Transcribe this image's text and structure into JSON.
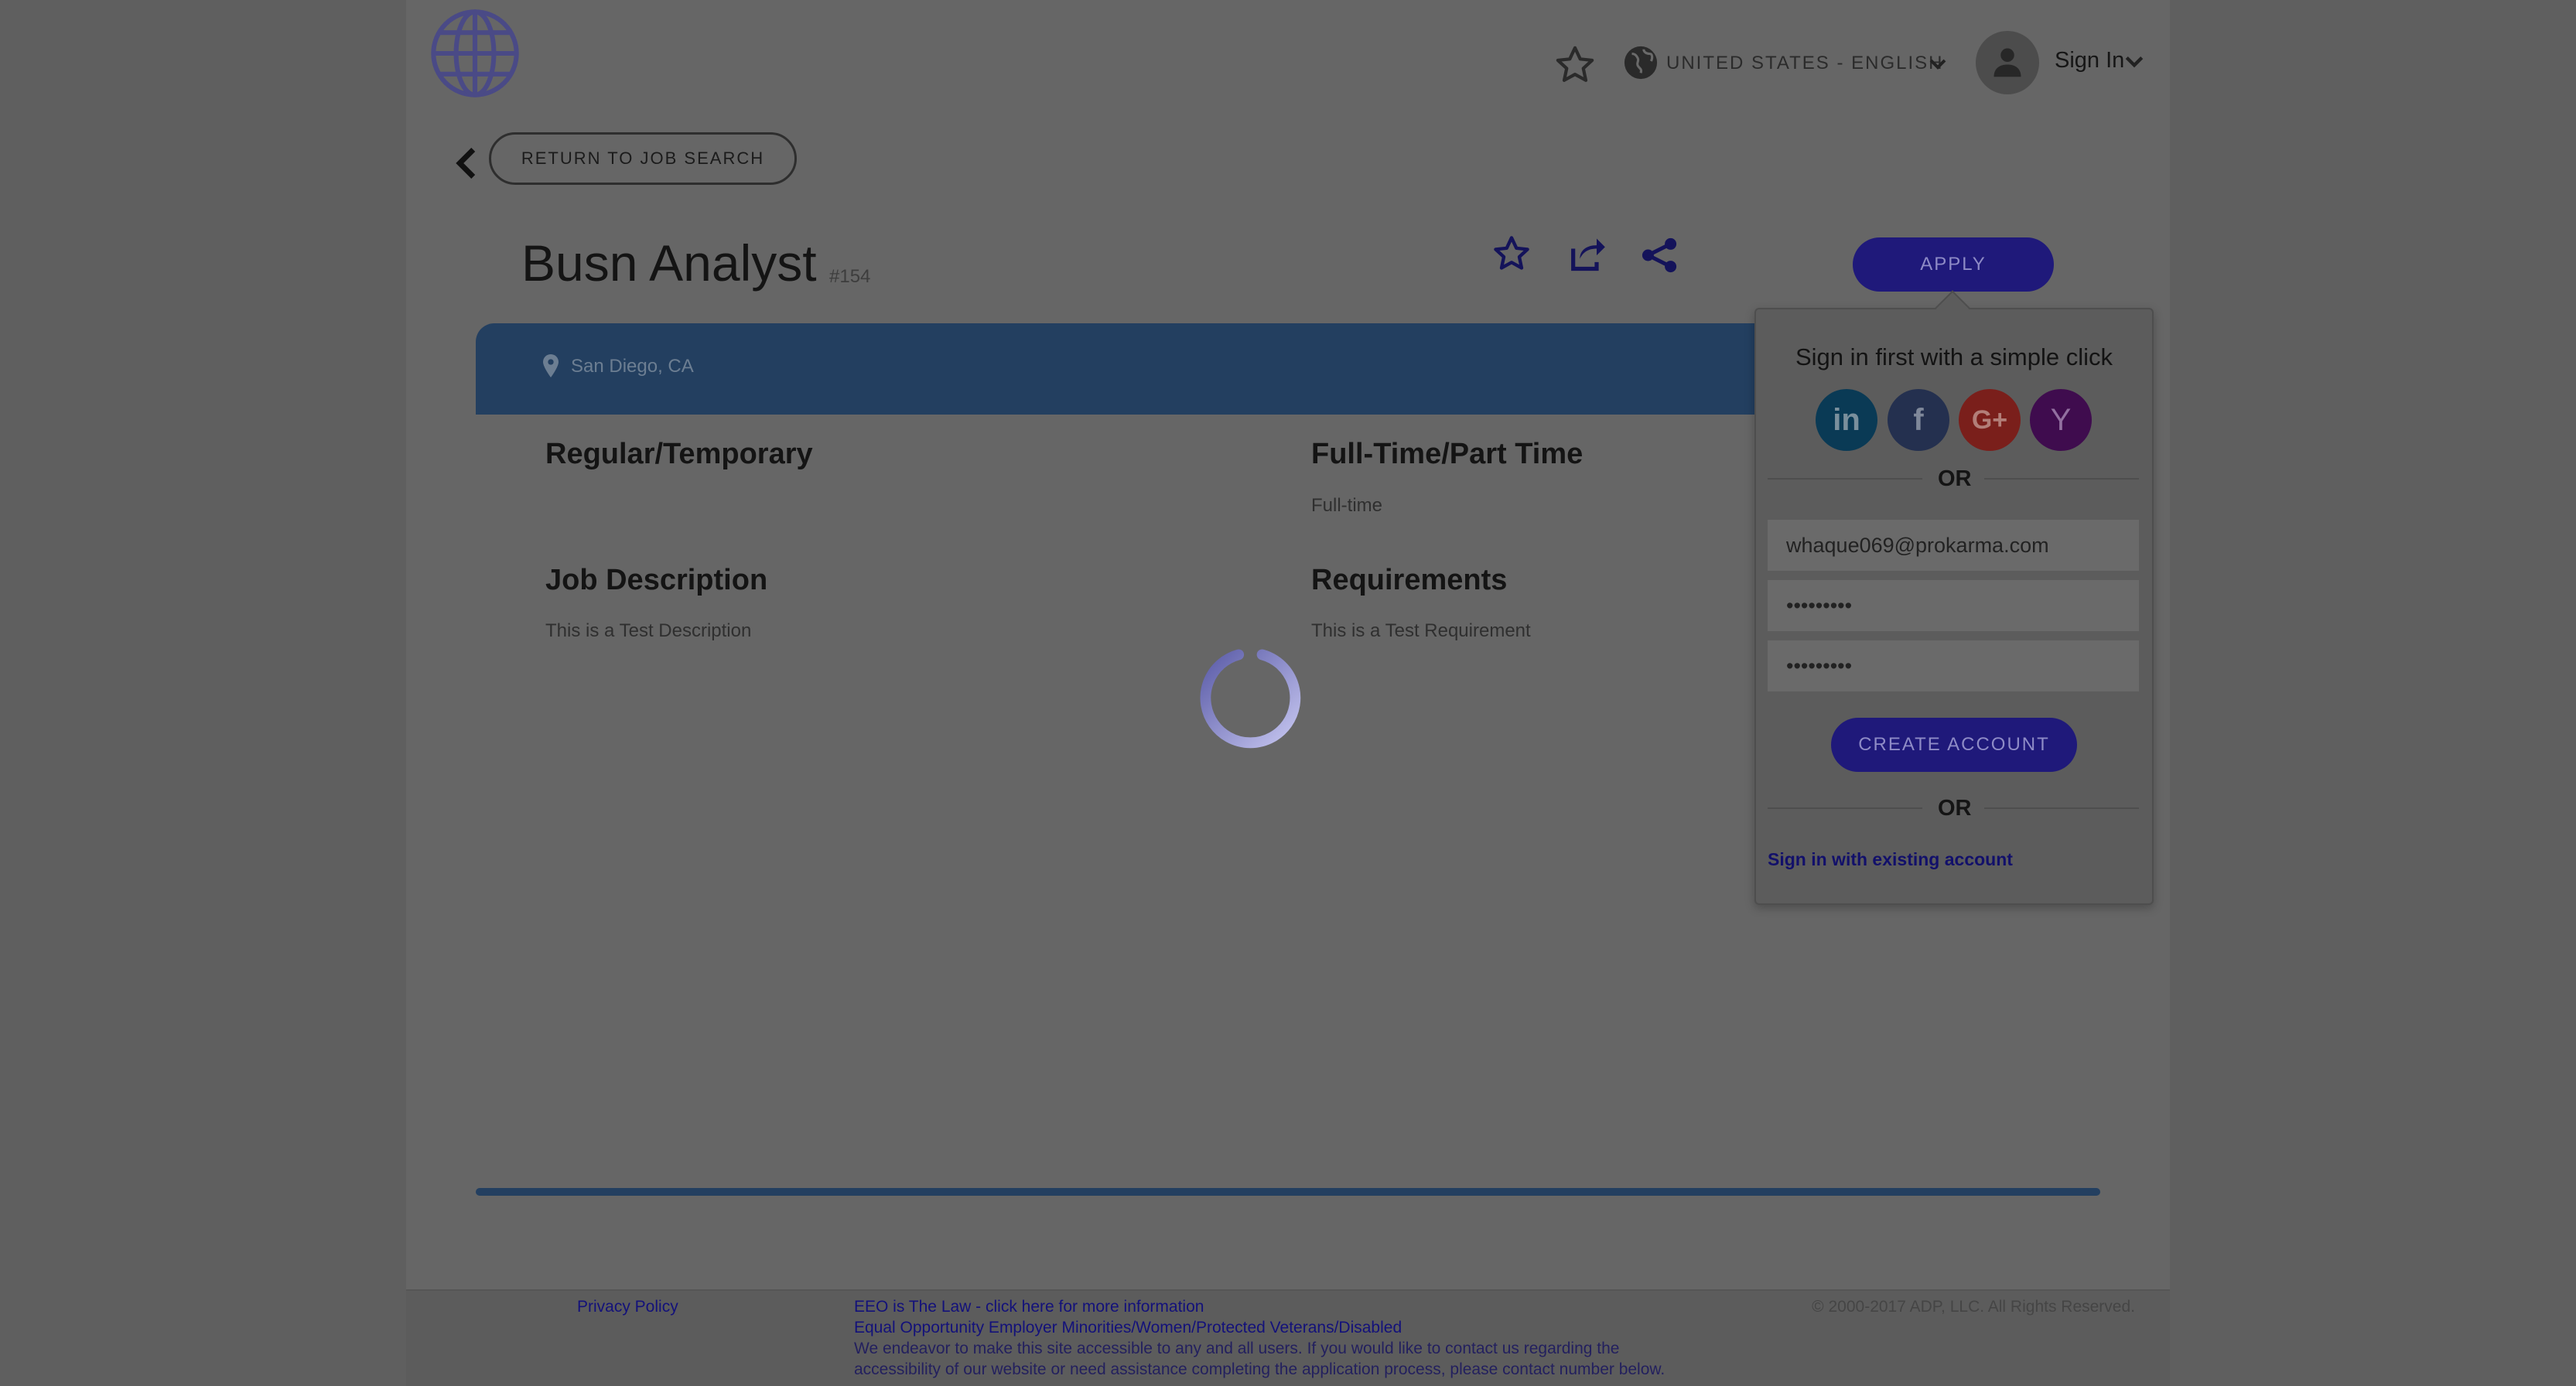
{
  "header": {
    "language": "UNITED STATES - ENGLISH",
    "signin_label": "Sign In"
  },
  "nav": {
    "return_label": "RETURN TO JOB SEARCH"
  },
  "job": {
    "title": "Busn Analyst",
    "number": "#154",
    "location": "San Diego, CA",
    "sections": {
      "regular_label": "Regular/Temporary",
      "regular_value": "",
      "fulltime_label": "Full-Time/Part Time",
      "fulltime_value": "Full-time",
      "description_label": "Job Description",
      "description_value": "This is a Test Description",
      "requirements_label": "Requirements",
      "requirements_value": "This is a Test Requirement"
    }
  },
  "apply": {
    "button_label": "APPLY",
    "heading": "Sign in first with a simple click",
    "social": [
      "in",
      "f",
      "G+",
      "Y"
    ],
    "or_label": "OR",
    "email_value": "whaque069@prokarma.com",
    "password_value": "•••••••••",
    "confirm_value": "•••••••••",
    "create_label": "CREATE ACCOUNT",
    "existing_label": "Sign in with existing account"
  },
  "footer": {
    "privacy": "Privacy Policy",
    "eeo": "EEO is The Law - click here for more information",
    "equal_opportunity": "Equal Opportunity Employer Minorities/Women/Protected Veterans/Disabled",
    "accessibility_1": "We endeavor to make this site accessible to any and all users. If you would like to contact us regarding the",
    "accessibility_2": "accessibility of our website or need assistance completing the application process, please contact number below.",
    "copyright": "© 2000-2017 ADP, LLC. All Rights Reserved."
  },
  "colors": {
    "overlay": "#666666",
    "brand_bar": "#233f60",
    "primary_button": "#1f197a",
    "linkedin": "#0a3a55",
    "facebook": "#24304f",
    "google": "#7a1f1b",
    "yahoo": "#3f0c4e"
  }
}
